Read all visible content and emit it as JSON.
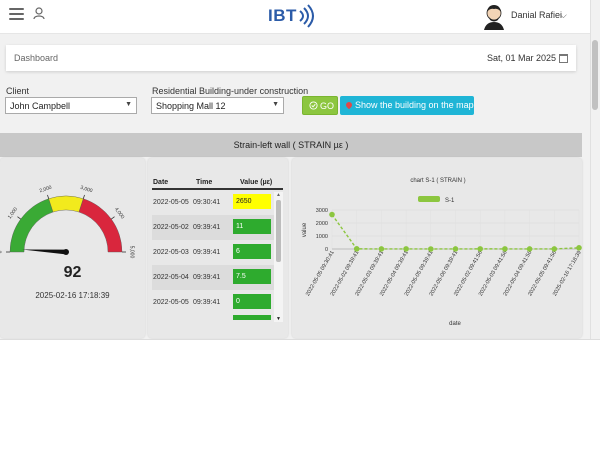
{
  "header": {
    "logo_text": "IBT",
    "user_name": "Danial Rafiei",
    "caret": "⌵"
  },
  "breadcrumb": {
    "label": "Dashboard",
    "date": "Sat, 01 Mar 2025"
  },
  "filters": {
    "client_label": "Client",
    "client_value": "John Campbell",
    "building_label": "Residential Building-under construction",
    "building_value": "Shopping Mall 12",
    "go_label": "GO",
    "map_label": "Show the building on the map"
  },
  "section_title": "Strain-left wall ( STRAIN µε )",
  "gauge": {
    "value": 92,
    "value_text": "92",
    "min": 0,
    "max": 5000,
    "timestamp": "2025-02-16 17:18:39",
    "tick_labels": [
      "0",
      "1,000",
      "2,000",
      "3,000",
      "4,000",
      "5,000"
    ],
    "colors": {
      "green": "#3aaa35",
      "yellow": "#f2ea1d",
      "red": "#d9263d"
    }
  },
  "table": {
    "headers": [
      "Date",
      "Time",
      "Value (µε)"
    ],
    "rows": [
      {
        "date": "2022-05-05",
        "time": "09:30:41",
        "value": "2650",
        "color": "#ffff00"
      },
      {
        "date": "2022-05-02",
        "time": "09:39:41",
        "value": "11",
        "color": "#2eab2e"
      },
      {
        "date": "2022-05-03",
        "time": "09:39:41",
        "value": "6",
        "color": "#2eab2e"
      },
      {
        "date": "2022-05-04",
        "time": "09:39:41",
        "value": "7.5",
        "color": "#2eab2e"
      },
      {
        "date": "2022-05-05",
        "time": "09:39:41",
        "value": "0",
        "color": "#2eab2e"
      }
    ]
  },
  "chart_data": {
    "type": "line",
    "title": "chart   S-1 ( STRAIN )",
    "xlabel": "date",
    "ylabel": "value",
    "ylim": [
      0,
      3000
    ],
    "yticks": [
      "0",
      "1000",
      "2000",
      "3000"
    ],
    "categories": [
      "2022-05-05 09:30:41",
      "2022-05-02 09:39:41",
      "2022-05-03 09:39:41",
      "2022-05-04 09:39:41",
      "2022-05-05 09:39:41",
      "2022-05-06 09:39:41",
      "2022-05-02 09:41:56",
      "2022-05-03 09:41:56",
      "2022-05-04 09:41:56",
      "2022-05-05 09:41:56",
      "2025-02-16 17:18:39"
    ],
    "series": [
      {
        "name": "S-1",
        "values": [
          2650,
          11,
          6,
          7.5,
          0,
          5,
          10,
          8,
          6,
          4,
          92
        ],
        "color": "#8cc63f"
      }
    ],
    "grid": true,
    "legend": "top-center"
  }
}
